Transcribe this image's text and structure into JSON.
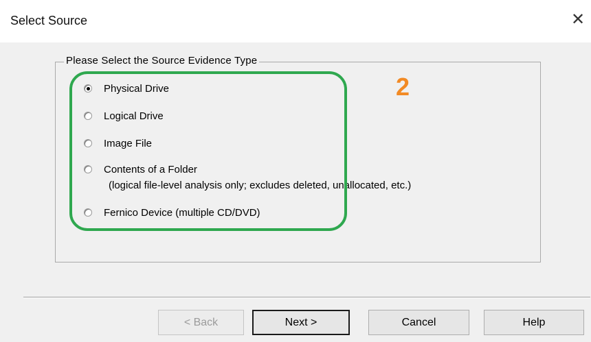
{
  "window": {
    "title": "Select Source",
    "close_symbol": "✕"
  },
  "group": {
    "legend": "Please Select the Source Evidence Type",
    "options": [
      {
        "label": "Physical Drive",
        "selected": true
      },
      {
        "label": "Logical Drive",
        "selected": false
      },
      {
        "label": "Image File",
        "selected": false
      },
      {
        "label": "Contents of a Folder",
        "selected": false
      },
      {
        "label": "Fernico Device (multiple CD/DVD)",
        "selected": false
      }
    ],
    "folder_note": "(logical file-level analysis only; excludes deleted, unallocated, etc.)"
  },
  "annotation": {
    "step_number": "2",
    "highlight_color": "#2fa84f",
    "step_color": "#f28a24"
  },
  "buttons": {
    "back": "< Back",
    "next": "Next >",
    "cancel": "Cancel",
    "help": "Help"
  }
}
